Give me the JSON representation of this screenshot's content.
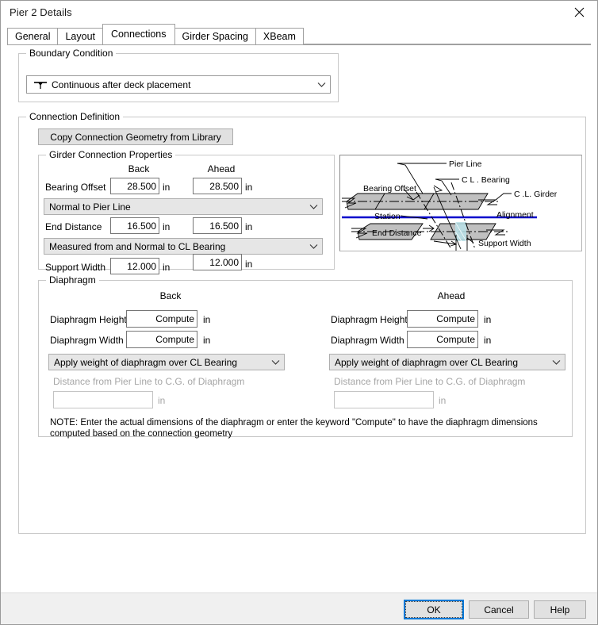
{
  "window": {
    "title": "Pier 2 Details",
    "close_icon": "close-icon"
  },
  "tabs": [
    {
      "label": "General",
      "active": false
    },
    {
      "label": "Layout",
      "active": false
    },
    {
      "label": "Connections",
      "active": true
    },
    {
      "label": "Girder Spacing",
      "active": false
    },
    {
      "label": "XBeam",
      "active": false
    }
  ],
  "boundary_condition": {
    "legend": "Boundary Condition",
    "value": "Continuous after deck placement",
    "icon": "pier-support-icon",
    "chevron": "chevron-down-icon"
  },
  "connection_definition": {
    "legend": "Connection Definition",
    "copy_button": "Copy Connection Geometry from Library",
    "girder_properties": {
      "legend": "Girder Connection Properties",
      "col_back": "Back",
      "col_ahead": "Ahead",
      "rows": [
        {
          "label": "Bearing Offset",
          "back": "28.500",
          "ahead": "28.500",
          "unit_back": "in",
          "unit_ahead": "in"
        },
        {
          "label": "End Distance",
          "back": "16.500",
          "ahead": "16.500",
          "unit_back": "in",
          "unit_ahead": "in"
        },
        {
          "label": "Support Width",
          "back": "12.000",
          "ahead": "12.000",
          "unit_back": "in",
          "unit_ahead": "in"
        }
      ],
      "combo_bearing_offset": "Normal to Pier Line",
      "combo_end_distance": "Measured from and Normal to CL Bearing"
    }
  },
  "diagram": {
    "labels": {
      "pier_line": "Pier Line",
      "cl_bearing": "C L . Bearing",
      "cl_girder": "C .L. Girder",
      "bearing_offset": "Bearing Offset",
      "station": "Station",
      "alignment": "Alignment",
      "end_distance": "End Distance",
      "support_width": "Support Width"
    },
    "colors": {
      "girder_fill": "#c0c0c0",
      "alignment_line": "#0000cc",
      "support_hatch": "#b8e0e8"
    }
  },
  "diaphragm": {
    "legend": "Diaphragm",
    "col_back": "Back",
    "col_ahead": "Ahead",
    "back": {
      "height_label": "Diaphragm Height",
      "height_value": "Compute",
      "height_unit": "in",
      "width_label": "Diaphragm Width",
      "width_value": "Compute",
      "width_unit": "in",
      "combo": "Apply weight of diaphragm over CL Bearing",
      "distance_label": "Distance from Pier Line to C.G. of Diaphragm",
      "distance_value": "",
      "distance_unit": "in"
    },
    "ahead": {
      "height_label": "Diaphragm Height",
      "height_value": "Compute",
      "height_unit": "in",
      "width_label": "Diaphragm Width",
      "width_value": "Compute",
      "width_unit": "in",
      "combo": "Apply weight of diaphragm over CL Bearing",
      "distance_label": "Distance from Pier Line to C.G. of Diaphragm",
      "distance_value": "",
      "distance_unit": "in"
    },
    "note": "NOTE: Enter the actual dimensions of the diaphragm or enter the keyword \"Compute\" to have the diaphragm dimensions computed based on the connection geometry"
  },
  "footer": {
    "ok": "OK",
    "cancel": "Cancel",
    "help": "Help"
  },
  "colors": {
    "accent": "#0078d7",
    "combo_bg": "#e6e6e6",
    "button_bg": "#e1e1e1",
    "group_border": "#c8c8c8"
  }
}
